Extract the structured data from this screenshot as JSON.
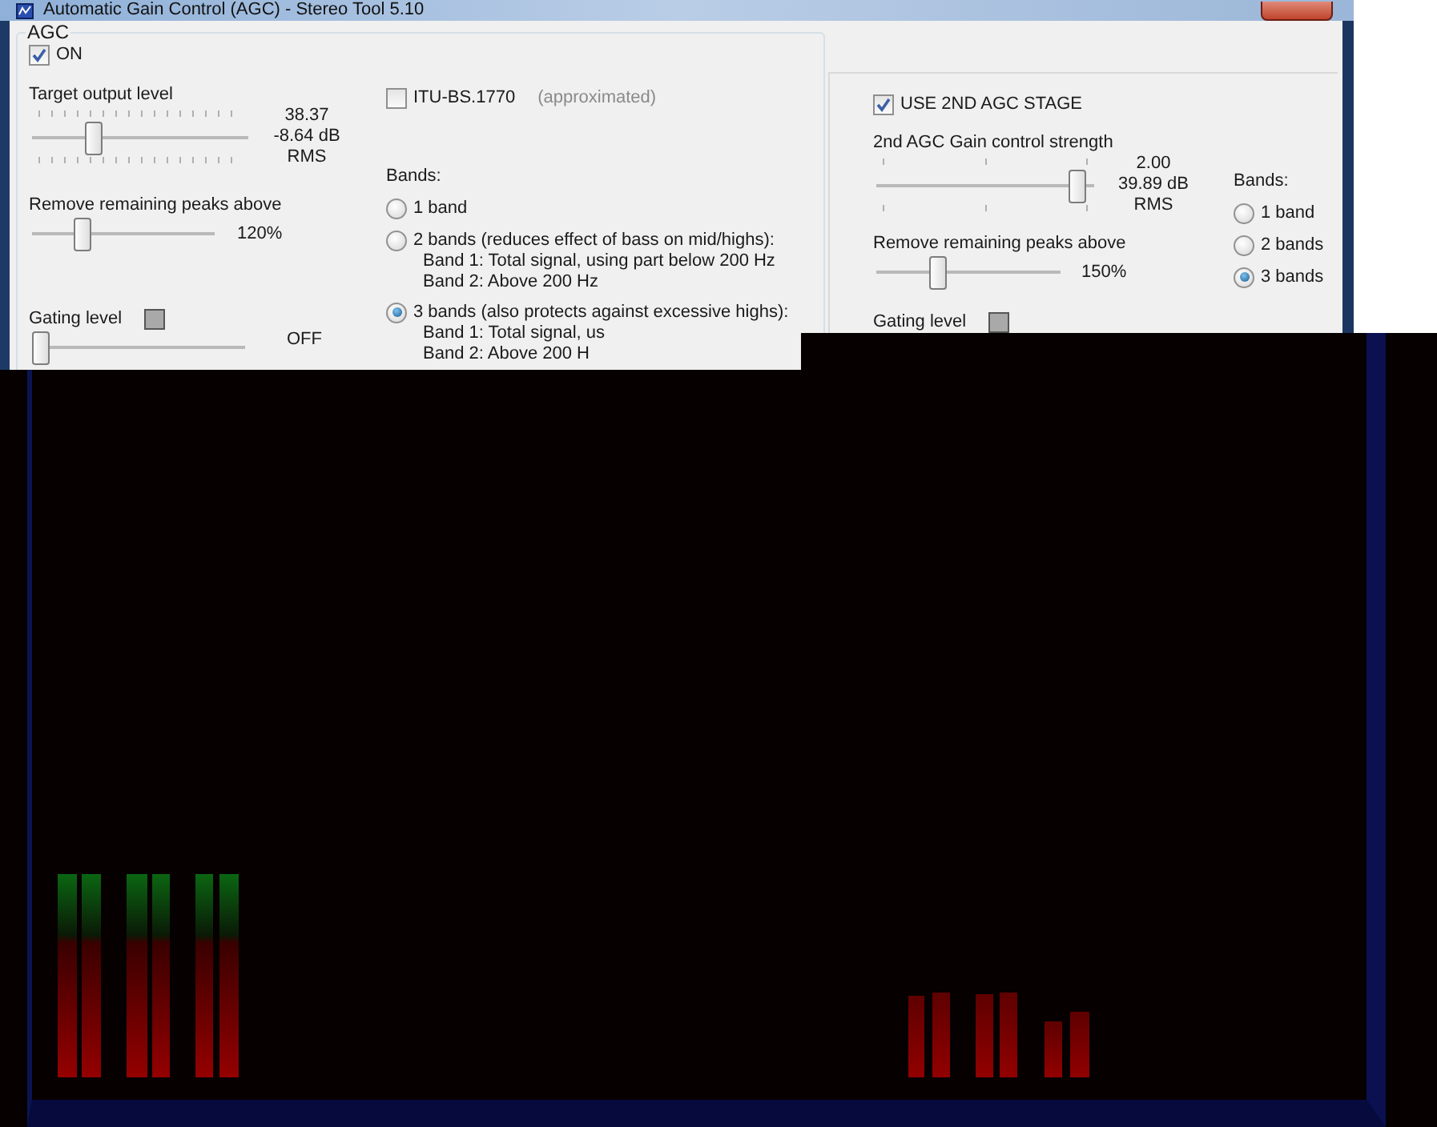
{
  "window": {
    "title": "Automatic Gain Control (AGC) - Stereo Tool 5.10"
  },
  "agc": {
    "group_label": "AGC",
    "on": {
      "label": "ON",
      "checked": true
    },
    "sliders": [
      {
        "kind": "fineticks",
        "label": "Target output level",
        "level": 0.27,
        "readings": [
          "38.37",
          "-8.64 dB",
          "RMS"
        ]
      },
      {
        "kind": "plain",
        "label": "Remove remaining peaks above",
        "level": 0.25,
        "readings": [
          "120%"
        ]
      },
      {
        "kind": "gating",
        "label": "Gating level",
        "level": 0,
        "readings": [
          "OFF"
        ]
      }
    ],
    "itu": {
      "label": "ITU-BS.1770",
      "note": "(approximated)",
      "checked": false
    },
    "bands": {
      "label": "Bands:",
      "options": [
        {
          "label": "1 band",
          "selected": false
        },
        {
          "label": "2 bands (reduces effect of bass on mid/highs):",
          "selected": false,
          "details": [
            "Band 1: Total signal, using part below 200 Hz",
            "Band 2: Above 200 Hz"
          ]
        },
        {
          "label": "3 bands (also protects against excessive highs):",
          "selected": true,
          "details": [
            "Band 1: Total signal, us",
            "Band 2: Above 200 H"
          ]
        }
      ]
    }
  },
  "second_stage": {
    "enable": {
      "label": "USE 2ND AGC STAGE",
      "checked": true
    },
    "sliders": [
      {
        "kind": "coarseticks",
        "label": "2nd AGC Gain control strength",
        "level": 0.96,
        "readings": [
          "2.00",
          "39.89 dB",
          "RMS"
        ]
      },
      {
        "kind": "plain",
        "label": "Remove remaining peaks above",
        "level": 0.32,
        "readings": [
          "150%"
        ]
      },
      {
        "kind": "gating",
        "label": "Gating level"
      }
    ],
    "bands": {
      "label": "Bands:",
      "options": [
        {
          "label": "1 band",
          "selected": false
        },
        {
          "label": "2 bands",
          "selected": false
        },
        {
          "label": "3 bands",
          "selected": true
        }
      ]
    }
  }
}
